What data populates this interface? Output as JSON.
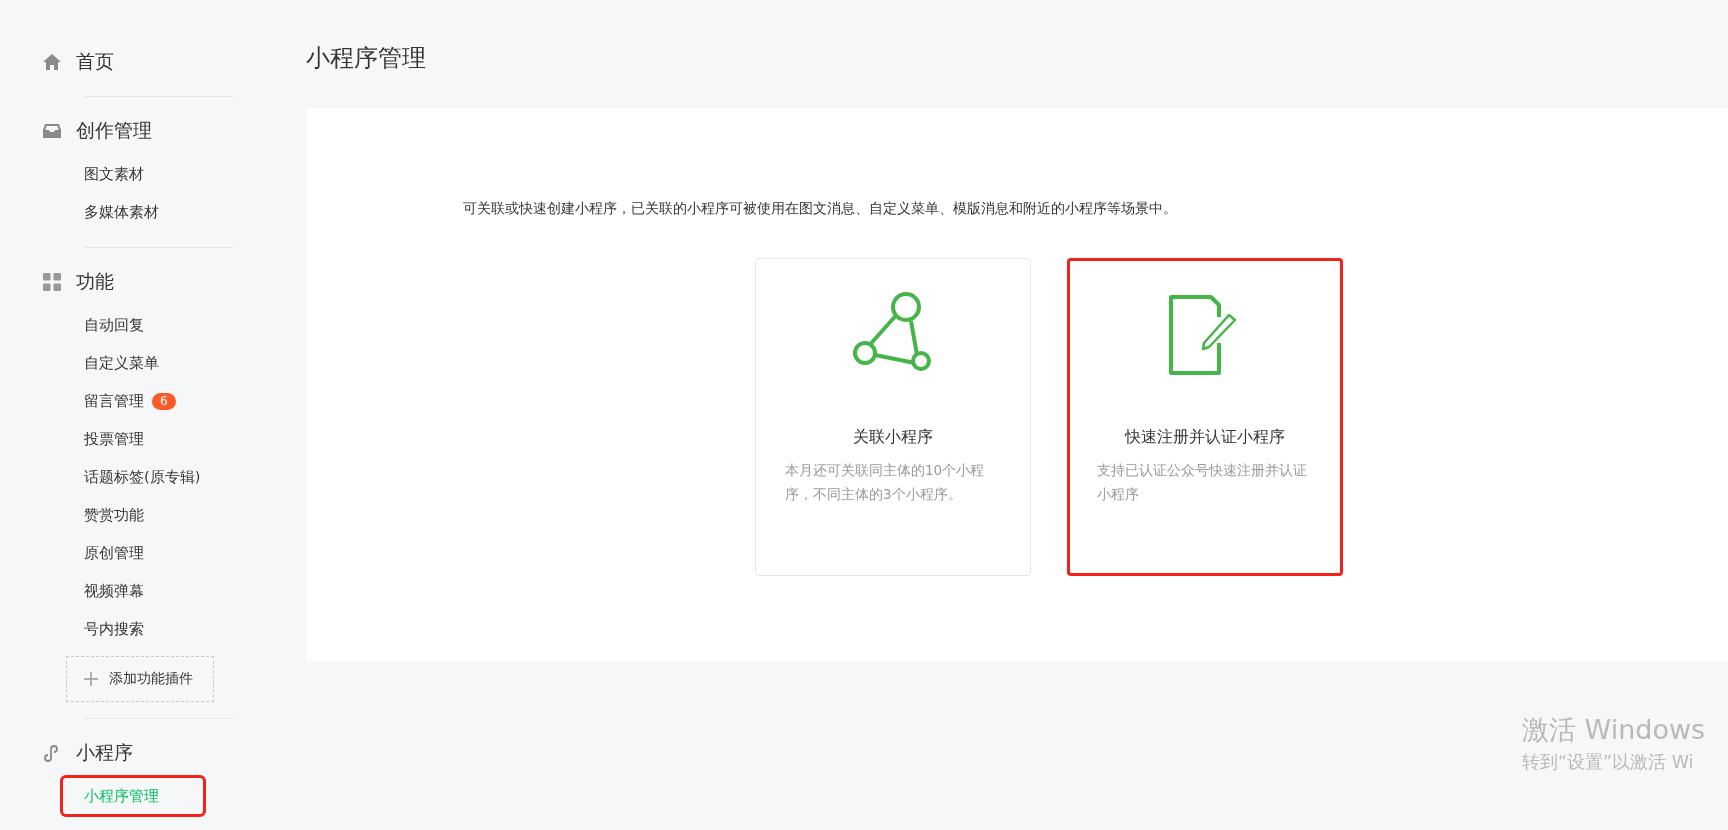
{
  "sidebar": {
    "sections": [
      {
        "title": "首页",
        "kind": "home"
      },
      {
        "title": "创作管理",
        "kind": "inbox",
        "items": [
          {
            "label": "图文素材",
            "selected": false,
            "highlighted": false
          },
          {
            "label": "多媒体素材",
            "selected": false,
            "highlighted": false
          }
        ]
      },
      {
        "title": "功能",
        "kind": "grid",
        "items": [
          {
            "label": "自动回复",
            "selected": false,
            "highlighted": false
          },
          {
            "label": "自定义菜单",
            "selected": false,
            "highlighted": false
          },
          {
            "label": "留言管理",
            "selected": false,
            "highlighted": false,
            "badge": "6"
          },
          {
            "label": "投票管理",
            "selected": false,
            "highlighted": false
          },
          {
            "label": "话题标签(原专辑)",
            "selected": false,
            "highlighted": false
          },
          {
            "label": "赞赏功能",
            "selected": false,
            "highlighted": false
          },
          {
            "label": "原创管理",
            "selected": false,
            "highlighted": false
          },
          {
            "label": "视频弹幕",
            "selected": false,
            "highlighted": false
          },
          {
            "label": "号内搜索",
            "selected": false,
            "highlighted": false
          }
        ],
        "add_button": "添加功能插件"
      },
      {
        "title": "小程序",
        "kind": "link",
        "items": [
          {
            "label": "小程序管理",
            "selected": true,
            "highlighted": true
          }
        ]
      }
    ]
  },
  "page": {
    "title": "小程序管理",
    "description": "可关联或快速创建小程序，已关联的小程序可被使用在图文消息、自定义菜单、模版消息和附近的小程序等场景中。",
    "cards": [
      {
        "kind": "link",
        "title": "关联小程序",
        "text": "本月还可关联同主体的10个小程序，不同主体的3个小程序。",
        "highlighted": false
      },
      {
        "kind": "register",
        "title": "快速注册并认证小程序",
        "text": "支持已认证公众号快速注册并认证小程序",
        "highlighted": true
      }
    ]
  },
  "os_notice": {
    "title": "激活 Windows",
    "text": "转到“设置”以激活 Wi"
  }
}
